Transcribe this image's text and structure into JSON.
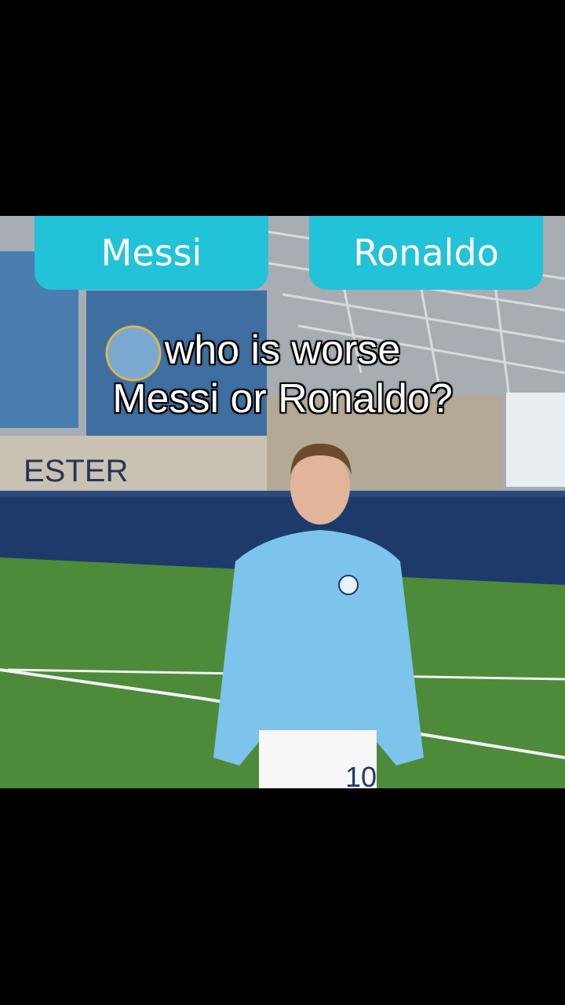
{
  "video": {
    "choice_left": "Messi",
    "choice_right": "Ronaldo",
    "question_line1": "who is worse",
    "question_line2": "Messi or Ronaldo?",
    "shirt_number": "10",
    "wall_letters": "ESTER"
  },
  "colors": {
    "choice_bg": "#22c2d9",
    "pitch": "#4d8a3a",
    "jacket": "#7cc4ec",
    "barrier": "#1e3a6b"
  }
}
